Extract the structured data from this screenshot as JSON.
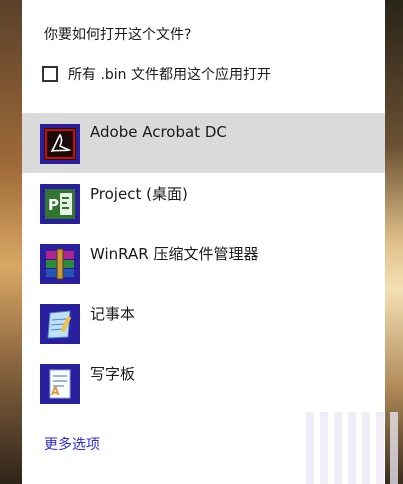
{
  "dialog": {
    "question": "你要如何打开这个文件?",
    "always_use_label": "所有 .bin 文件都用这个应用打开",
    "always_use_checked": false,
    "more_options": "更多选项"
  },
  "apps": [
    {
      "name": "Adobe Acrobat DC",
      "icon": "adobe-acrobat-icon",
      "selected": true
    },
    {
      "name": "Project (桌面)",
      "icon": "ms-project-icon",
      "selected": false
    },
    {
      "name": "WinRAR 压缩文件管理器",
      "icon": "winrar-icon",
      "selected": false
    },
    {
      "name": "记事本",
      "icon": "notepad-icon",
      "selected": false
    },
    {
      "name": "写字板",
      "icon": "wordpad-icon",
      "selected": false
    }
  ],
  "colors": {
    "selected_bg": "#dadada",
    "link": "#2b2bd6",
    "icon_tile": "#2a1f9e",
    "project_green": "#31752f",
    "acrobat_red": "#d10a0a"
  }
}
